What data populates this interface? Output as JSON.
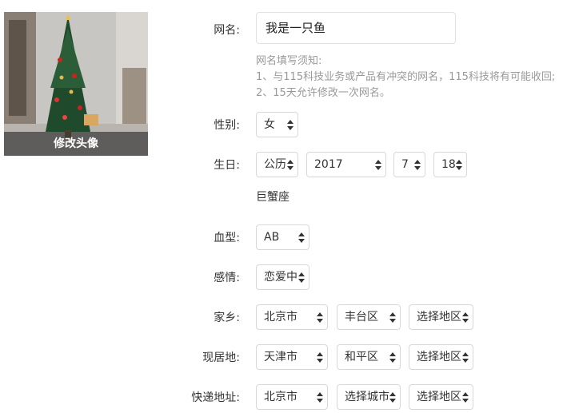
{
  "avatar": {
    "caption": "修改头像"
  },
  "nickname": {
    "label": "网名:",
    "value": "我是一只鱼",
    "notice_title": "网名填写须知:",
    "notice_line1": "1、与115科技业务或产品有冲突的网名，115科技将有可能收回;",
    "notice_line2": "2、15天允许修改一次网名。"
  },
  "gender": {
    "label": "性别:",
    "value": "女"
  },
  "birthday": {
    "label": "生日:",
    "calendar": "公历",
    "year": "2017",
    "month": "7",
    "day": "18",
    "zodiac": "巨蟹座"
  },
  "blood": {
    "label": "血型:",
    "value": "AB"
  },
  "relationship": {
    "label": "感情:",
    "value": "恋爱中"
  },
  "hometown": {
    "label": "家乡:",
    "province": "北京市",
    "district": "丰台区",
    "area": "选择地区"
  },
  "residence": {
    "label": "现居地:",
    "province": "天津市",
    "district": "和平区",
    "area": "选择地区"
  },
  "shipping": {
    "label": "快递地址:",
    "province": "北京市",
    "city": "选择城市",
    "area": "选择地区"
  }
}
